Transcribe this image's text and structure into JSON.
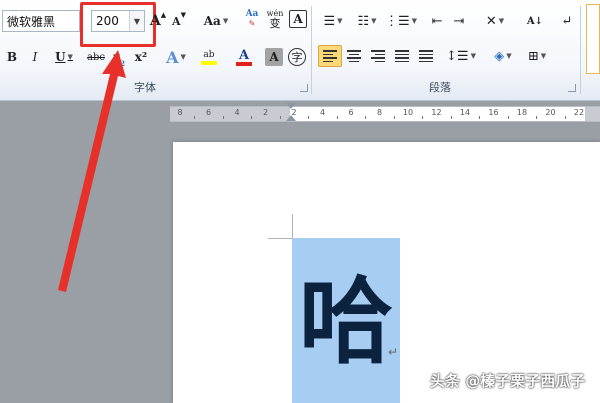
{
  "ribbon": {
    "font_group_label": "字体",
    "paragraph_group_label": "段落",
    "font_name": "微软雅黑",
    "font_size": "200",
    "grow_font": "A",
    "shrink_font": "A",
    "change_case": "Aa",
    "phonetic": "wén",
    "phonetic_char": "变",
    "char_border": "A",
    "bold": "B",
    "italic": "I",
    "underline": "U",
    "strikethrough": "abc",
    "subscript": "x",
    "superscript": "x²",
    "text_effects": "A",
    "highlight": "ab",
    "font_color": "A",
    "char_shading": "A",
    "enclose_char": "字",
    "sort": "A↓"
  },
  "ruler": {
    "numbers": [
      "8",
      "6",
      "4",
      "2",
      "2",
      "4",
      "6",
      "8",
      "10",
      "12",
      "14",
      "16",
      "18",
      "20",
      "22"
    ]
  },
  "document": {
    "character": "哈",
    "paragraph_mark": "↵"
  },
  "watermark": "头条 @榛子栗子西瓜子",
  "colors": {
    "highlight_box": "#e8302a",
    "selection": "#a8cdf2",
    "arrow": "#e8302a"
  }
}
